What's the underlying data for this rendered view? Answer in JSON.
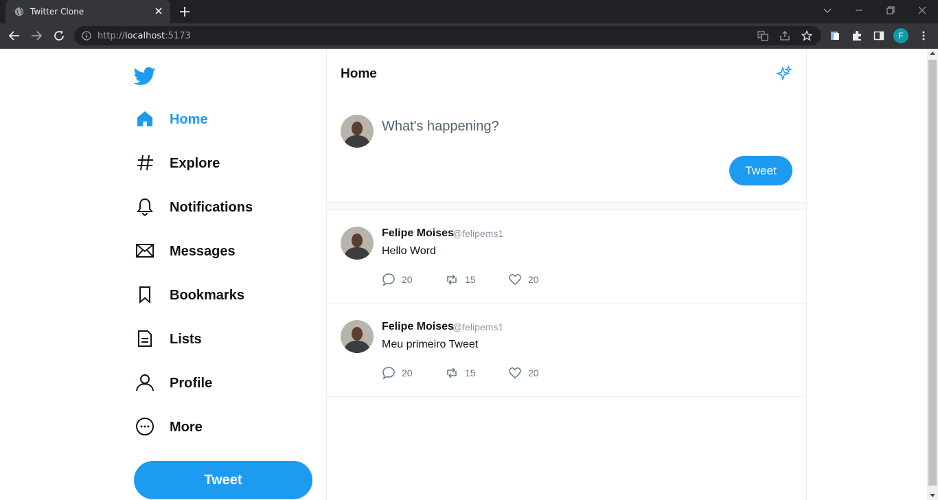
{
  "browser": {
    "tab_title": "Twitter Clone",
    "url_prefix": "http://",
    "url_host": "localhost",
    "url_port": ":5173",
    "profile_initial": "F"
  },
  "sidebar": {
    "items": [
      {
        "label": "Home",
        "icon": "home-icon",
        "active": true
      },
      {
        "label": "Explore",
        "icon": "hashtag-icon"
      },
      {
        "label": "Notifications",
        "icon": "bell-icon"
      },
      {
        "label": "Messages",
        "icon": "envelope-icon"
      },
      {
        "label": "Bookmarks",
        "icon": "bookmark-icon"
      },
      {
        "label": "Lists",
        "icon": "list-icon"
      },
      {
        "label": "Profile",
        "icon": "user-icon"
      },
      {
        "label": "More",
        "icon": "more-icon"
      }
    ],
    "tweet_button": "Tweet"
  },
  "main": {
    "title": "Home",
    "composer": {
      "placeholder": "What's happening?",
      "button": "Tweet"
    },
    "tweets": [
      {
        "name": "Felipe Moises",
        "handle": "@felipems1",
        "text": "Hello Word",
        "replies": "20",
        "retweets": "15",
        "likes": "20"
      },
      {
        "name": "Felipe Moises",
        "handle": "@felipems1",
        "text": "Meu primeiro Tweet",
        "replies": "20",
        "retweets": "15",
        "likes": "20"
      }
    ]
  },
  "colors": {
    "accent": "#1d9bf0",
    "chrome_dark": "#202124",
    "chrome_toolbar": "#35363a"
  }
}
